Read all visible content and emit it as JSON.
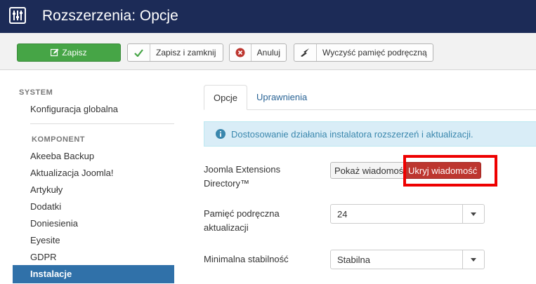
{
  "header": {
    "title": "Rozszerzenia: Opcje"
  },
  "toolbar": {
    "save": "Zapisz",
    "save_close": "Zapisz i zamknij",
    "cancel": "Anuluj",
    "clear_cache": "Wyczyść pamięć podręczną"
  },
  "sidebar": {
    "system_heading": "SYSTEM",
    "system_items": [
      "Konfiguracja globalna"
    ],
    "component_heading": "KOMPONENT",
    "component_items": [
      "Akeeba Backup",
      "Aktualizacja Joomla!",
      "Artykuły",
      "Dodatki",
      "Doniesienia",
      "Eyesite",
      "GDPR"
    ],
    "active_item": "Instalacje"
  },
  "tabs": [
    "Opcje",
    "Uprawnienia"
  ],
  "alert": {
    "text": "Dostosowanie działania instalatora rozszerzeń i aktualizacji."
  },
  "form": {
    "jed_label_1": "Joomla Extensions",
    "jed_label_2": "Directory™",
    "jed_show": "Pokaż wiadomość",
    "jed_hide": "Ukryj wiadomość",
    "cache_label_1": "Pamięć podręczna",
    "cache_label_2": "aktualizacji",
    "cache_value": "24",
    "stability_label": "Minimalna stabilność",
    "stability_value": "Stabilna"
  },
  "colors": {
    "header_bg": "#1c2b57",
    "save_green": "#46a546",
    "active_red": "#bd362f",
    "highlight": "#ee0000",
    "sidebar_active": "#3071a9"
  }
}
